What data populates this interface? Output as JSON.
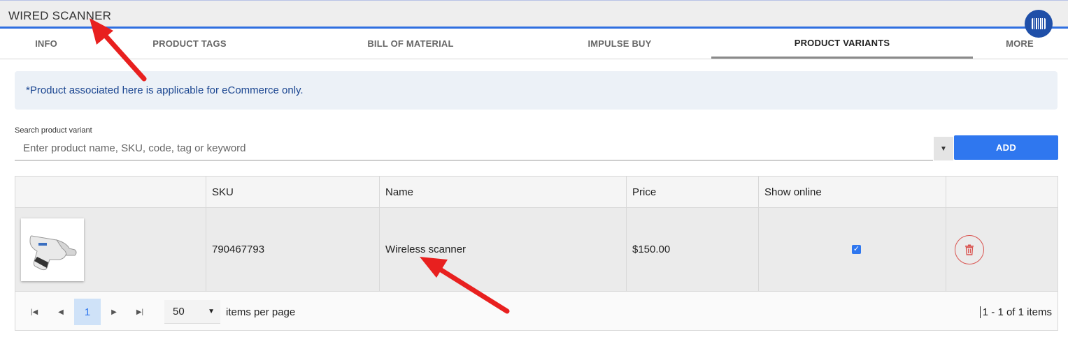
{
  "header": {
    "title": "WIRED SCANNER",
    "barcode_icon": "barcode-icon"
  },
  "tabs": [
    {
      "label": "INFO"
    },
    {
      "label": "PRODUCT TAGS"
    },
    {
      "label": "BILL OF MATERIAL"
    },
    {
      "label": "IMPULSE BUY"
    },
    {
      "label": "PRODUCT VARIANTS",
      "active": true
    },
    {
      "label": "MORE"
    }
  ],
  "notice": {
    "text": "*Product associated here is applicable for eCommerce only."
  },
  "search": {
    "label": "Search product variant",
    "placeholder": "Enter product name, SKU, code, tag or keyword",
    "value": "",
    "add_label": "ADD"
  },
  "table": {
    "columns": [
      "",
      "SKU",
      "Name",
      "Price",
      "Show online",
      ""
    ],
    "rows": [
      {
        "image_icon": "scanner-image",
        "sku": "790467793",
        "name": "Wireless scanner",
        "price": "$150.00",
        "show_online": true
      }
    ]
  },
  "pager": {
    "current_page": "1",
    "page_size": "50",
    "items_per_page_label": "items per page",
    "range_text": "1 - 1 of 1 items"
  },
  "colors": {
    "accent": "#2f77ef",
    "title_underline": "#2f6fe0",
    "annotation_arrow": "#e8201f",
    "delete": "#d9534f"
  }
}
